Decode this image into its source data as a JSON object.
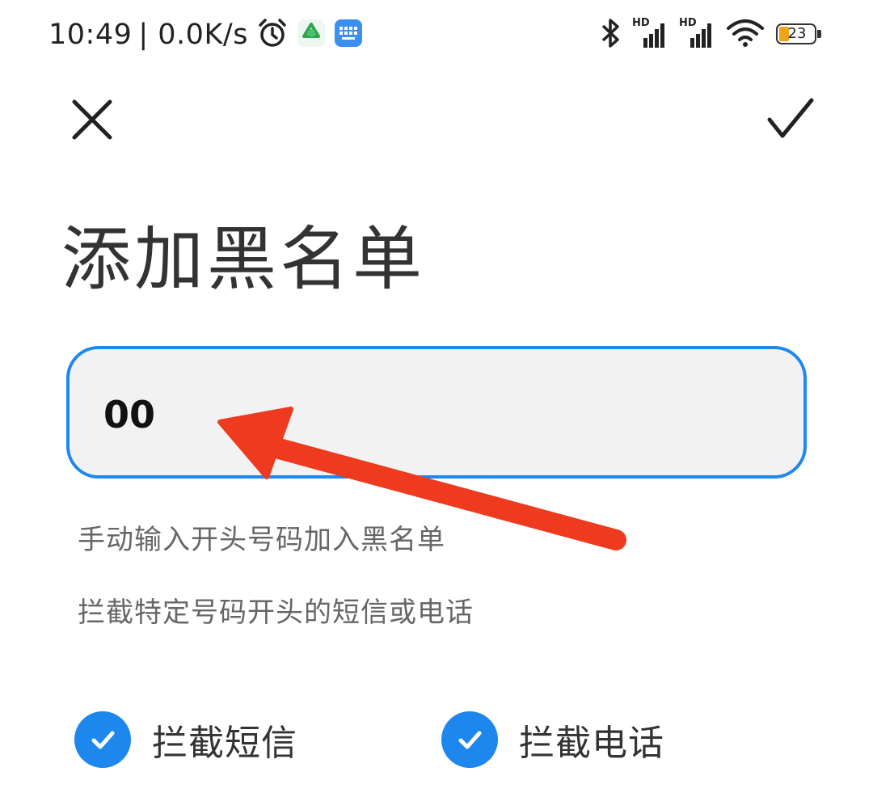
{
  "status_bar": {
    "time": "10:49",
    "net_speed": "| 0.0K/s",
    "battery": "23",
    "hd_label": "HD",
    "icons": [
      "alarm-icon",
      "app-notification-icon",
      "keyboard-icon",
      "bluetooth-icon",
      "signal-hd-icon",
      "signal-hd-icon",
      "wifi-icon",
      "battery-icon"
    ]
  },
  "toolbar": {
    "close_icon": "close-icon",
    "confirm_icon": "checkmark-icon"
  },
  "page": {
    "title": "添加黑名单"
  },
  "input": {
    "value": "00"
  },
  "hints": {
    "line1": "手动输入开头号码加入黑名单",
    "line2": "拦截特定号码开头的短信或电话"
  },
  "options": {
    "block_sms": {
      "label": "拦截短信",
      "checked": true
    },
    "block_calls": {
      "label": "拦截电话",
      "checked": true
    }
  },
  "colors": {
    "accent": "#1e88ee",
    "annotation_arrow": "#ee3b1f",
    "input_bg": "#f2f2f2"
  }
}
